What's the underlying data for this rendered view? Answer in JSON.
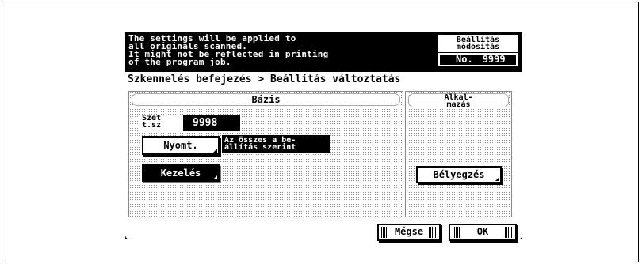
{
  "message": {
    "line1": "The settings will be applied to",
    "line2": "all originals scanned.",
    "line3": "It might not be reflected in printing",
    "line4": "of the program job."
  },
  "info": {
    "title_line1": "Beállítás",
    "title_line2": "módosítás",
    "no_label": "No.",
    "no_value": "9999"
  },
  "breadcrumb": "Szkennelés befejezés > Beállítás változtatás",
  "left_panel": {
    "title": "Bázis",
    "setsz_label_line1": "Szet",
    "setsz_label_line2": "t.sz",
    "setsz_value": "9998",
    "nyomt_label": "Nyomt.",
    "nyomt_desc_line1": "Az összes a be-",
    "nyomt_desc_line2": "állítás szerint",
    "kezeles_label": "Kezelés"
  },
  "right_panel": {
    "title_line1": "Alkal-",
    "title_line2": "mazás",
    "belyegzes_label": "Bélyegzés"
  },
  "footer": {
    "cancel_label": "Mégse",
    "ok_label": "OK"
  }
}
